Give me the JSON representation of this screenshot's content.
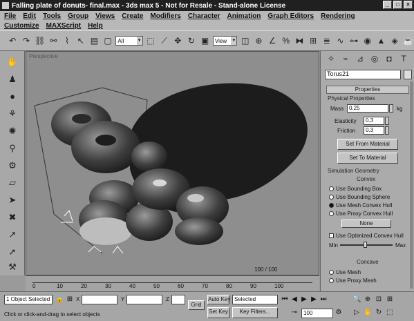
{
  "window": {
    "title": "Falling plate of donuts- final.max - 3ds max 5 - Not for Resale - Stand-alone License",
    "buttons": [
      "_",
      "□",
      "×"
    ]
  },
  "menu": {
    "row1": [
      "File",
      "Edit",
      "Tools",
      "Group",
      "Views",
      "Create",
      "Modifiers",
      "Character",
      "Animation",
      "Graph Editors",
      "Rendering"
    ],
    "row2": [
      "Customize",
      "MAXScript",
      "Help"
    ]
  },
  "toolbar": {
    "selection_filter": "All",
    "ref_coord": "View",
    "icons": [
      "undo-icon",
      "redo-icon",
      "link-icon",
      "unlink-icon",
      "bind-icon",
      "select-icon",
      "select-name-icon",
      "region-icon",
      "move-icon",
      "rotate-icon",
      "scale-icon",
      "mirror-icon",
      "align-icon",
      "material-icon",
      "render-icon",
      "teapot-icon"
    ]
  },
  "left_toolbar": {
    "icons": [
      "reactor-icon",
      "rigid-body-icon",
      "sphere-icon",
      "cloth-icon",
      "soft-body-icon",
      "rope-icon",
      "spring-icon",
      "plane-icon",
      "wind-icon",
      "toy-car-icon",
      "fracture-icon",
      "water-icon",
      "preview-icon"
    ]
  },
  "viewport": {
    "label": "Perspective"
  },
  "command_panel": {
    "object_name": "Torus21",
    "properties_title": "Properties",
    "physical_properties_title": "Physical Properties",
    "mass_label": "Mass",
    "mass_value": "0.25",
    "mass_unit": "kg",
    "elasticity_label": "Elasticity",
    "elasticity_value": "0.3",
    "friction_label": "Friction",
    "friction_value": "0.3",
    "set_from_material": "Set From Material",
    "set_to_material": "Set To Material",
    "sim_geometry_title": "Simulation Geometry",
    "convex_title": "Convex",
    "convex_options": [
      {
        "label": "Use Bounding Box",
        "selected": false
      },
      {
        "label": "Use Bounding Sphere",
        "selected": false
      },
      {
        "label": "Use Mesh Convex Hull",
        "selected": true
      },
      {
        "label": "Use Proxy Convex Hull",
        "selected": false
      }
    ],
    "none_button": "None",
    "optimized_hull": "Use Optimized Convex Hull",
    "slider_min": "Min",
    "slider_max": "Max",
    "concave_title": "Concave",
    "concave_options": [
      "Use Mesh",
      "Use Proxy Mesh"
    ]
  },
  "timeline": {
    "frame_display": "100 / 100",
    "ticks": [
      "0",
      "10",
      "20",
      "30",
      "40",
      "50",
      "60",
      "70",
      "80",
      "90",
      "100"
    ]
  },
  "status": {
    "selection": "1 Object Selected",
    "prompt": "Click or click-and-drag to select objects",
    "x_label": "X",
    "y_label": "Y",
    "z_label": "Z",
    "grid_button": "Grid",
    "auto_key": "Auto Key",
    "selected_dropdown": "Selected",
    "set_key": "Set Key",
    "key_filters": "Key Filters...",
    "current_frame": "100"
  }
}
